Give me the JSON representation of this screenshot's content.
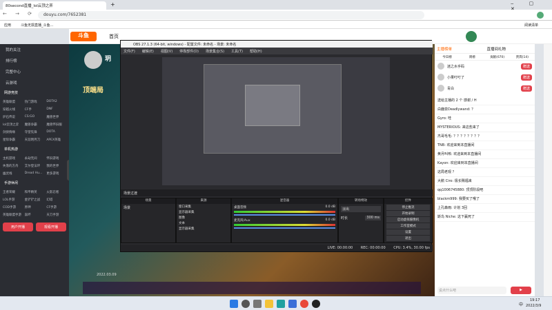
{
  "browser": {
    "tab_title": "80second直播_lol云顶之弈",
    "url": "douyu.com/7652381",
    "bookmarks": [
      "应用",
      "斗鱼无损直播_斗鱼..."
    ],
    "reading_list": "阅读清单"
  },
  "site": {
    "nav": [
      "首页"
    ],
    "logo": "斗鱼"
  },
  "left_nav": {
    "items": [
      "我的关注",
      "排行榜",
      "完整中心",
      "云游戏"
    ],
    "section1": "网游竞技",
    "grid1": [
      "英雄联盟",
      "热门游戏",
      "DOTA2",
      "穿越火线",
      "CF手",
      "DNF",
      "炉石传说",
      "CS:GO",
      "魔兽世界",
      "lol云顶之弈",
      "魔兽争霸",
      "魔兽怀旧服",
      "剑侠情缘",
      "守望先锋",
      "DOTA",
      "星际争霸",
      "天涯明月刀",
      "APEX英雄"
    ],
    "section2": "单机热游",
    "grid2": [
      "主机游戏",
      "永劫无间",
      "怀旧游戏",
      "失落的方舟",
      "艾尔登法环",
      "我的世界",
      "幽灵线",
      "Dread Hu...",
      "更多游戏"
    ],
    "section3": "手游休闲",
    "grid3": [
      "王者荣耀",
      "和平精英",
      "火影忍者",
      "LOL手游",
      "金铲铲之战",
      "幻塔",
      "COD手游",
      "原神",
      "CF手游",
      "英雄联盟手游",
      "崩坏",
      "天刀手游"
    ],
    "btn_record": "用户开播",
    "btn_live": "观看开播"
  },
  "stream": {
    "streamer_name": "玥",
    "banner_text": "顶端局",
    "view_count": "2022.03.09"
  },
  "obs": {
    "title": "OBS 27.1.3 (64-bit, windows) - 配置文件: 未命名 - 场景: 未命名",
    "menu": [
      "文件(F)",
      "编辑(E)",
      "视图(V)",
      "停靠部件(D)",
      "场景集合(S)",
      "工具(T)",
      "帮助(H)"
    ],
    "scene_header": "场景",
    "scene_item": "场景",
    "sources_header": "来源",
    "sources": [
      "窗口采集",
      "显示器采集",
      "图像",
      "文本",
      "显示器采集"
    ],
    "mixer_header": "混音器",
    "mixer_tracks": [
      {
        "name": "桌面音频",
        "db": "0.0 dB"
      },
      {
        "name": "麦克风/Aux",
        "db": "0.0 dB"
      }
    ],
    "transition_header": "转场特效",
    "transition_type": "淡出",
    "duration_label": "时长",
    "duration_value": "300 ms",
    "controls_header": "控件",
    "controls": [
      "停止推流",
      "开始录制",
      "启动虚拟摄像机",
      "工作室模式",
      "设置",
      "退出"
    ],
    "status": {
      "live": "LIVE: 00:00:00",
      "rec": "REC: 00:00:00",
      "cpu": "CPU: 3.4%, 30.00 fps"
    },
    "transition_bar": "场景过渡"
  },
  "chat": {
    "tabs": [
      "主播榜单",
      "直播间礼物"
    ],
    "tabs2": [
      "今日榜",
      "周榜",
      "贡献(670)",
      "贵宾(14)"
    ],
    "ranks": [
      {
        "name": "迷之水手码",
        "btn": "赠送"
      },
      {
        "name": "小果叮叮了",
        "btn": "赠送"
      },
      {
        "name": "青白",
        "btn": "赠送"
      }
    ],
    "messages": [
      "送给主播的 2 个 感谢 / H",
      "白鹿泉Deadlywand: ？",
      "Gyro: 哇",
      "MYSTERIOUS: 来这些来了",
      "杰哥毛毛: ？？？？？？？？",
      "TNB: 欢迎来到本直播间",
      "黄月叫咳: 欢迎来到本直播间",
      "Kayon: 欢迎来到本直播间",
      "这局老观 ？",
      "大鹅 Ciro: 极长赐福来",
      "qq1006745880: 顶顶阶段吧",
      "blackm999: 我要买了哦了",
      "上孔森雨: 计划 3回",
      "斯鸟 Niche: 这下赢死了"
    ],
    "input_placeholder": "说点什么吧"
  },
  "taskbar": {
    "time": "19:17",
    "date": "2022/3/9",
    "lang": "中"
  }
}
